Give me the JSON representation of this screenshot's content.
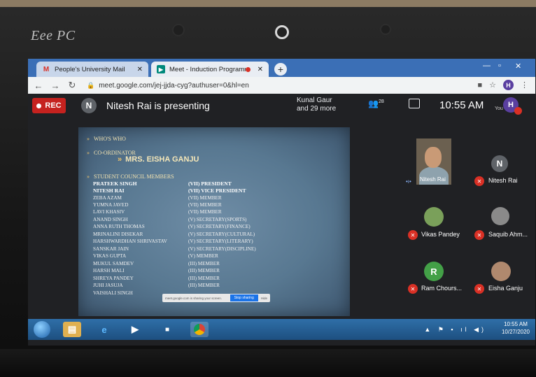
{
  "device": {
    "brand": "Eee PC"
  },
  "browser": {
    "tabs": [
      {
        "icon": "gmail-icon",
        "title": "People's University Mail"
      },
      {
        "icon": "meet-icon",
        "title": "Meet - Induction Programm"
      }
    ],
    "new_tab_label": "+",
    "url": "meet.google.com/jej-jjda-cyg?authuser=0&hl=en",
    "profile_initial": "H"
  },
  "meet": {
    "rec_label": "REC",
    "presenter_initial": "N",
    "presenting_text": "Nitesh Rai is presenting",
    "participants_line1": "Kunal Gaur",
    "participants_line2": "and 29 more",
    "people_count": "28",
    "time": "10:55 AM",
    "you_label": "You",
    "self_initial": "H"
  },
  "slide": {
    "heading1": "WHO'S WHO",
    "heading2": "CO-ORDINATOR",
    "coordinator": "MRS. EISHA GANJU",
    "heading3": "STUDENT COUNCIL MEMBERS",
    "members": [
      {
        "name": "PRATEEK SINGH",
        "role": "(VII) PRESIDENT"
      },
      {
        "name": "NITESH RAI",
        "role": "(VII) VICE PRESIDENT"
      },
      {
        "name": "ZEBA AZAM",
        "role": "(VII) MEMBER"
      },
      {
        "name": "YUMNA JAVED",
        "role": "(VII) MEMBER"
      },
      {
        "name": "LAVI KHASIV",
        "role": "(VII) MEMBER"
      },
      {
        "name": "ANAND SINGH",
        "role": "(V)   SECRETARY(SPORTS)"
      },
      {
        "name": "ANNA RUTH THOMAS",
        "role": "(V)  SECRETARY(FINANCE)"
      },
      {
        "name": "MRINALINI DISEKAR",
        "role": "(V)  SECRETARY(CULTURAL)"
      },
      {
        "name": "HARSHWARDHAN SHRIVASTAV",
        "role": "(V) SECRETARY(LITERARY)"
      },
      {
        "name": "SANSKAR JAIN",
        "role": "(V) SECRETARY(DISCIPLINE)"
      },
      {
        "name": "VIKAS GUPTA",
        "role": "(V) MEMBER"
      },
      {
        "name": "MUKUL SAMDEV",
        "role": "(III) MEMBER"
      },
      {
        "name": "HARSH MALI",
        "role": "(III) MEMBER"
      },
      {
        "name": "SHREYA PANDEY",
        "role": "(III) MEMBER"
      },
      {
        "name": "JUHI JASUJA",
        "role": "(III) MEMBER"
      },
      {
        "name": "VAISHALI SINGH",
        "role": ""
      }
    ],
    "share_message": "meet.google.com is sharing your screen.",
    "stop_sharing_label": "Stop sharing",
    "hide_label": "Hide"
  },
  "participants": [
    {
      "name": "Nitesh Rai",
      "type": "video"
    },
    {
      "name": "Nitesh Rai",
      "initial": "N",
      "color": "#5f6368"
    },
    {
      "name": "Vikas Pandey",
      "initial": "",
      "color": "#7aa05a"
    },
    {
      "name": "Saquib Ahm...",
      "initial": "",
      "color": "#8a8a8a"
    },
    {
      "name": "Ram Chours...",
      "initial": "R",
      "color": "#43a047"
    },
    {
      "name": "Eisha Ganju",
      "initial": "",
      "color": "#b0896e"
    }
  ],
  "taskbar": {
    "time": "10:55 AM",
    "date": "10/27/2020"
  }
}
